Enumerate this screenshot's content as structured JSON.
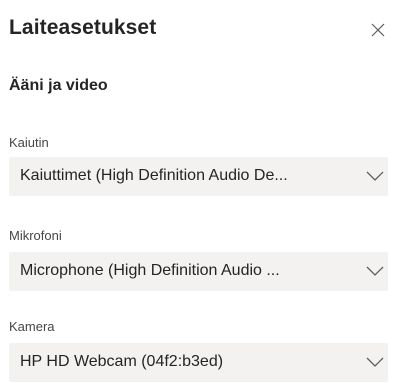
{
  "dialog": {
    "title": "Laiteasetukset",
    "close_icon": "close-icon"
  },
  "section": {
    "title": "Ääni ja video"
  },
  "speaker": {
    "label": "Kaiutin",
    "value": "Kaiuttimet (High Definition Audio De...",
    "icon": "chevron-down-icon"
  },
  "microphone": {
    "label": "Mikrofoni",
    "value": "Microphone (High Definition Audio ...",
    "icon": "chevron-down-icon"
  },
  "camera": {
    "label": "Kamera",
    "value": "HP HD Webcam (04f2:b3ed)",
    "icon": "chevron-down-icon"
  },
  "colors": {
    "background": "#ffffff",
    "dropdown_background": "#f3f2f1",
    "text_primary": "#252423",
    "text_secondary": "#484644",
    "icon": "#605e5c"
  }
}
